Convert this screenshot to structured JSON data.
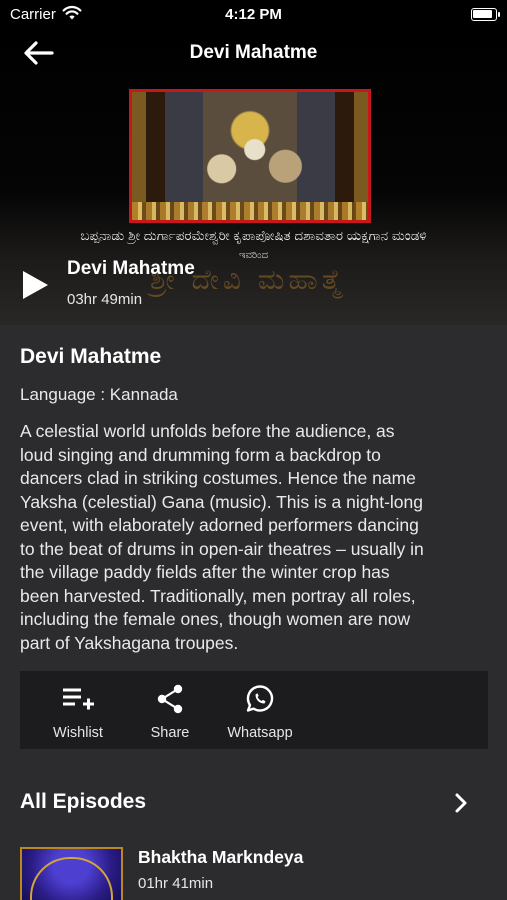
{
  "status_bar": {
    "carrier": "Carrier",
    "time": "4:12 PM"
  },
  "nav": {
    "title": "Devi Mahatme"
  },
  "hero": {
    "banner_line": "ಬಪ್ಪನಾಡು ಶ್ರೀ ದುರ್ಗಾಪರಮೇಶ್ವರೀ ಕೃಪಾಪೋಷಿತ ದಶಾವತಾರ ಯಕ್ಷಗಾನ ಮಂಡಳಿ",
    "banner_sub": "ಇವರಿಂದ",
    "banner_title": "ಶ್ರೀ ದೇವಿ ಮಹಾತ್ಮೆ",
    "title": "Devi Mahatme",
    "duration": "03hr 49min"
  },
  "details": {
    "title": "Devi Mahatme",
    "language": "Language : Kannada",
    "description_lines": [
      "A celestial world unfolds before the audience, as",
      "loud singing and drumming form a backdrop to",
      "dancers clad in striking costumes. Hence the name",
      "Yaksha (celestial) Gana (music). This is a night-long",
      "event, with elaborately adorned performers dancing",
      "to the beat of drums in open-air theatres – usually in",
      "the village paddy fields after the winter crop has",
      "been harvested. Traditionally, men portray all roles,",
      "including the female ones, though women are now",
      "part of Yakshagana troupes."
    ]
  },
  "actions": {
    "wishlist": {
      "label": "Wishlist",
      "icon": "playlist-add-icon"
    },
    "share": {
      "label": "Share",
      "icon": "share-icon"
    },
    "whatsapp": {
      "label": "Whatsapp",
      "icon": "whatsapp-icon"
    }
  },
  "episodes": {
    "section_title": "All Episodes",
    "items": [
      {
        "title": "Bhaktha Markndeya",
        "duration": "01hr 41min"
      }
    ]
  },
  "colors": {
    "background": "#2c2c2e",
    "action_bar": "#1c1c1e",
    "accent_red": "#c8171a"
  }
}
